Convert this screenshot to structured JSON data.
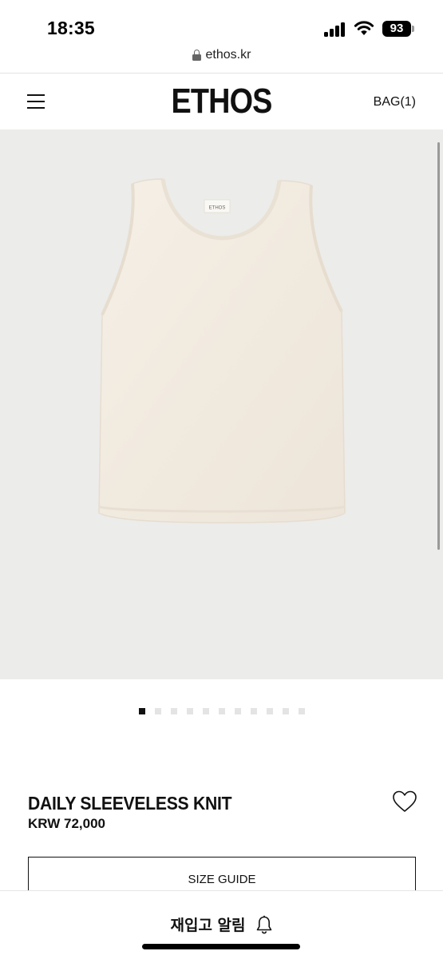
{
  "status_bar": {
    "time": "18:35",
    "battery": "93",
    "icons": [
      "signal-icon",
      "wifi-icon",
      "battery-icon"
    ]
  },
  "browser": {
    "url": "ethos.kr"
  },
  "header": {
    "logo": "ETHOS",
    "bag": "BAG(1)"
  },
  "gallery": {
    "image_alt": "ivory sleeveless knit top",
    "slide_count": 11,
    "active_index": 0
  },
  "product": {
    "name": "DAILY SLEEVELESS KNIT",
    "price": "KRW 72,000",
    "size_guide": "SIZE GUIDE",
    "garment_label": "ETHOS"
  },
  "bottom_bar": {
    "restock_alert": "재입고 알림"
  }
}
